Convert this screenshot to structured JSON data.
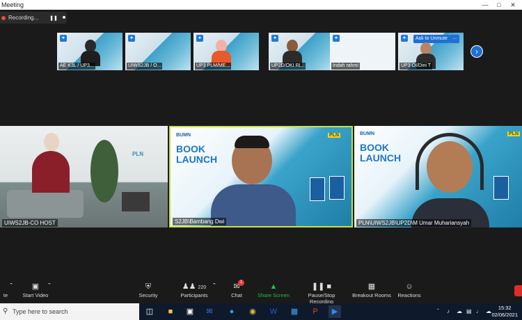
{
  "window": {
    "title": "Meeting"
  },
  "recording": {
    "label": "Recording...",
    "pause_icon": "pause-icon",
    "stop_icon": "stop-icon"
  },
  "thumbnails": [
    {
      "name": "AE K3L / UP3..."
    },
    {
      "name": "UIWS2JB / O..."
    },
    {
      "name": "UP3 PLM/ME..."
    },
    {
      "name": "UP2D/OKI RI..."
    },
    {
      "name": "Indah rahmi"
    },
    {
      "name": "UP3 OI/Dini T"
    }
  ],
  "thumb_overlay": {
    "ask_unmute": "Ask to Unmute",
    "more": "..."
  },
  "tiles": [
    {
      "name": "UIWS2JB-CO HOST"
    },
    {
      "name": "S2JB\\Bambang Dwi"
    },
    {
      "name": "PLN\\UIWS2JB\\UP2D\\M Umar Muhariansyah"
    }
  ],
  "slide": {
    "line1": "BOOK",
    "line2": "LAUNCH",
    "pln": "PLN",
    "bumn": "BUMN"
  },
  "toolbar": {
    "mute_tail": "te",
    "video": "Start Video",
    "security": "Security",
    "participants": "Participants",
    "participant_count": "220",
    "chat": "Chat",
    "chat_badge": "1",
    "share": "Share Screen",
    "record": "Pause/Stop Recording",
    "breakout": "Breakout Rooms",
    "reactions": "Reactions"
  },
  "taskbar": {
    "search_placeholder": "Type here to search",
    "time": "15:32",
    "date": "02/06/2021"
  },
  "colors": {
    "active_speaker": "#c7e23b",
    "share_green": "#1fbf4e",
    "zoom_blue": "#1f6fd6",
    "end_red": "#e02b2b"
  }
}
